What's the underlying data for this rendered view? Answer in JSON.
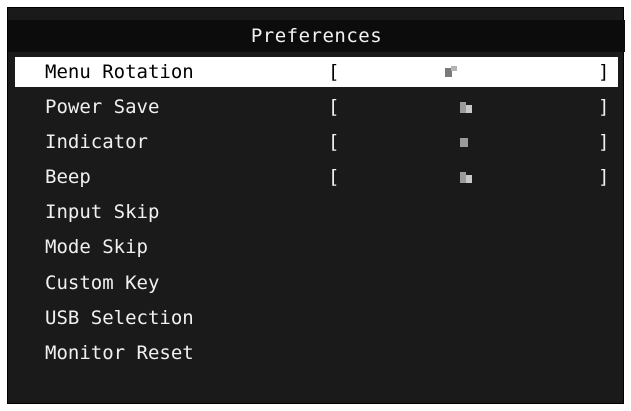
{
  "window": {
    "title": "Preferences"
  },
  "menu": {
    "items": [
      {
        "label": "Menu Rotation",
        "bracket_open": "[",
        "bracket_close": "]",
        "value_icon": "pixelated-status-icon",
        "selected": true
      },
      {
        "label": "Power Save",
        "bracket_open": "[",
        "bracket_close": "]",
        "value_icon": "pixelated-status-icon",
        "selected": false
      },
      {
        "label": "Indicator",
        "bracket_open": "[",
        "bracket_close": "]",
        "value_icon": "pixelated-status-icon",
        "selected": false
      },
      {
        "label": "Beep",
        "bracket_open": "[",
        "bracket_close": "]",
        "value_icon": "pixelated-status-icon",
        "selected": false
      },
      {
        "label": "Input Skip",
        "selected": false
      },
      {
        "label": "Mode Skip",
        "selected": false
      },
      {
        "label": "Custom Key",
        "selected": false
      },
      {
        "label": "USB Selection",
        "selected": false
      },
      {
        "label": "Monitor Reset",
        "selected": false
      }
    ]
  },
  "colors": {
    "background": "#1a1a1a",
    "title_bar": "#0c0c0c",
    "text": "#f0f0f0",
    "selected_bg": "#ffffff",
    "selected_text": "#000000"
  }
}
